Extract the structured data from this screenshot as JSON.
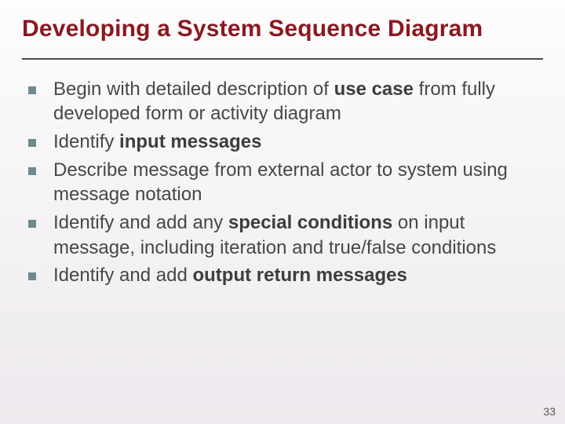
{
  "title": "Developing a System Sequence Diagram",
  "items": [
    {
      "pre": "Begin with detailed description of ",
      "bold": "use case",
      "post": " from fully developed form or activity diagram"
    },
    {
      "pre": "Identify ",
      "bold": "input messages",
      "post": ""
    },
    {
      "pre": "Describe message from external actor to system using message notation",
      "bold": "",
      "post": ""
    },
    {
      "pre": "Identify and add any ",
      "bold": "special conditions",
      "post": " on input message, including iteration and true/false conditions"
    },
    {
      "pre": "Identify and add ",
      "bold": "output return messages",
      "post": ""
    }
  ],
  "page_number": "33"
}
